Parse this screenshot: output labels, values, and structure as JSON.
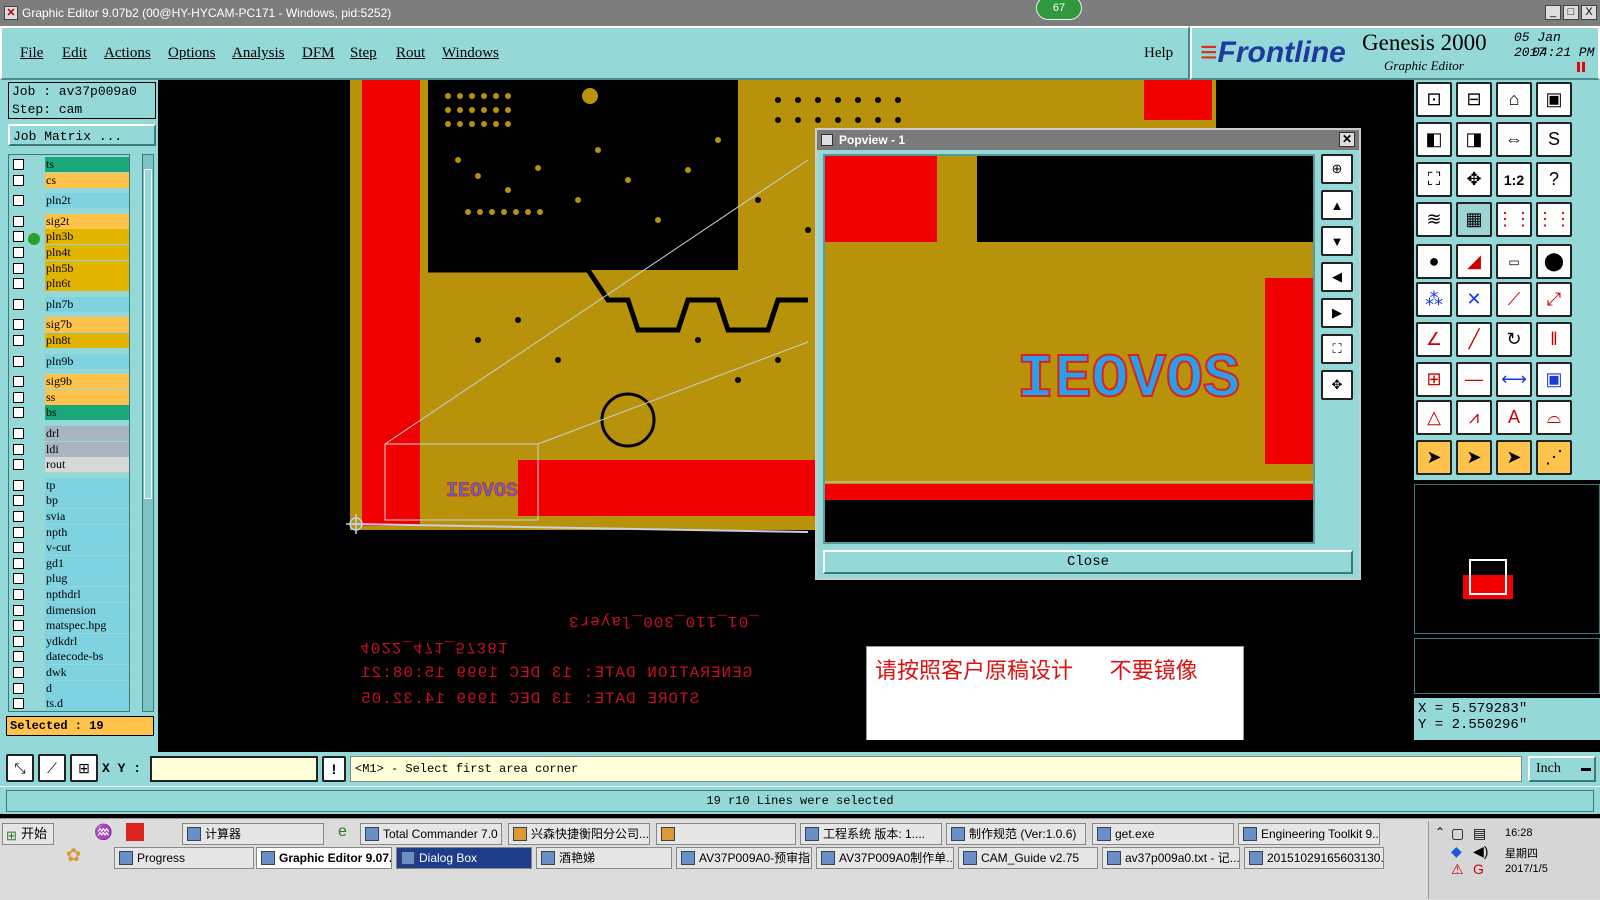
{
  "titlebar": {
    "title": "Graphic Editor 9.07b2 (00@HY-HYCAM-PC171 - Windows, pid:5252)",
    "badge": "67",
    "min": "_",
    "max": "□",
    "close": "X"
  },
  "menu": [
    "File",
    "Edit",
    "Actions",
    "Options",
    "Analysis",
    "DFM",
    "Step",
    "Rout",
    "Windows"
  ],
  "help": "Help",
  "brand": {
    "logo": "Frontline",
    "product": "Genesis 2000",
    "subtitle": "Graphic Editor",
    "date": "05 Jan 2017",
    "time": "04:21 PM"
  },
  "job": {
    "job_label": "Job : av37p009a0",
    "step_label": "Step: cam",
    "matrix_button": "Job Matrix ...",
    "selected": "Selected : 19"
  },
  "layers": [
    {
      "name": "ts",
      "color": "#1aa87a"
    },
    {
      "name": "cs",
      "color": "#ffc24a"
    },
    {
      "name": "pln2t",
      "color": "#7fd2e0"
    },
    {
      "name": "sig2t",
      "color": "#ffc24a"
    },
    {
      "name": "pln3b",
      "color": "#e2b400"
    },
    {
      "name": "pln4t",
      "color": "#e2b400"
    },
    {
      "name": "pln5b",
      "color": "#e2b400"
    },
    {
      "name": "pln6t",
      "color": "#e2b400"
    },
    {
      "name": "pln7b",
      "color": "#7fd2e0"
    },
    {
      "name": "sig7b",
      "color": "#ffc24a"
    },
    {
      "name": "pln8t",
      "color": "#e2b400"
    },
    {
      "name": "pln9b",
      "color": "#7fd2e0"
    },
    {
      "name": "sig9b",
      "color": "#ffc24a"
    },
    {
      "name": "ss",
      "color": "#ffc24a"
    },
    {
      "name": "bs",
      "color": "#1aa87a"
    },
    {
      "name": "drl",
      "color": "#a8b4c0"
    },
    {
      "name": "ldi",
      "color": "#a8b4c0"
    },
    {
      "name": "rout",
      "color": "#d8d8d8"
    },
    {
      "name": "tp",
      "color": "#7fd2e0"
    },
    {
      "name": "bp",
      "color": "#7fd2e0"
    },
    {
      "name": "svia",
      "color": "#7fd2e0"
    },
    {
      "name": "npth",
      "color": "#7fd2e0"
    },
    {
      "name": "v-cut",
      "color": "#7fd2e0"
    },
    {
      "name": "gd1",
      "color": "#7fd2e0"
    },
    {
      "name": "plug",
      "color": "#7fd2e0"
    },
    {
      "name": "npthdrl",
      "color": "#7fd2e0"
    },
    {
      "name": "dimension",
      "color": "#7fd2e0"
    },
    {
      "name": "matspec.hpg",
      "color": "#7fd2e0"
    },
    {
      "name": "ydkdrl",
      "color": "#7fd2e0"
    },
    {
      "name": "datecode-bs",
      "color": "#7fd2e0"
    },
    {
      "name": "dwk",
      "color": "#7fd2e0"
    },
    {
      "name": "d",
      "color": "#7fd2e0"
    },
    {
      "name": "ts.d",
      "color": "#7fd2e0"
    }
  ],
  "canvas": {
    "board_text": "IEOVOS",
    "mirror_lines": [
      "_01_110_300_layer3",
      "4022_471_57381",
      "GENERATION DATE: 13 DEC 1999 15:08:21",
      "STORE DATE: 13 DEC 1999 14.32.05"
    ],
    "note": "请按照客户原稿设计      不要镜像"
  },
  "popview": {
    "title": "Popview - 1",
    "close_label": "Close",
    "text": "IEOVOS"
  },
  "coords": {
    "x": "X = 5.579283\"",
    "y": "Y = 2.550296\""
  },
  "cmd": {
    "xy_label": "X Y :",
    "xy_value": "",
    "prompt": "<M1> - Select first area corner",
    "units": "Inch"
  },
  "status": "19 r10 Lines were selected",
  "taskbar": {
    "start": "开始",
    "row1": [
      "计算器",
      "Total Commander 7.0 ...",
      "兴森快捷衡阳分公司...",
      "",
      "工程系统  版本: 1....",
      "制作规范 (Ver:1.0.6)",
      "get.exe",
      "Engineering Toolkit 9...."
    ],
    "row2": [
      "Progress",
      "Graphic Editor 9.07...",
      "Dialog Box",
      "酒艳娣",
      "AV37P009A0-预审指...",
      "AV37P009A0制作单...",
      "CAM_Guide v2.75",
      "av37p009a0.txt - 记...",
      "20151029165603130..."
    ],
    "clock": "16:28",
    "weekday": "星期四",
    "date": "2017/1/5"
  },
  "colors": {
    "panel": "#95d8d8",
    "copper": "#b8920a",
    "red": "#f00000"
  }
}
